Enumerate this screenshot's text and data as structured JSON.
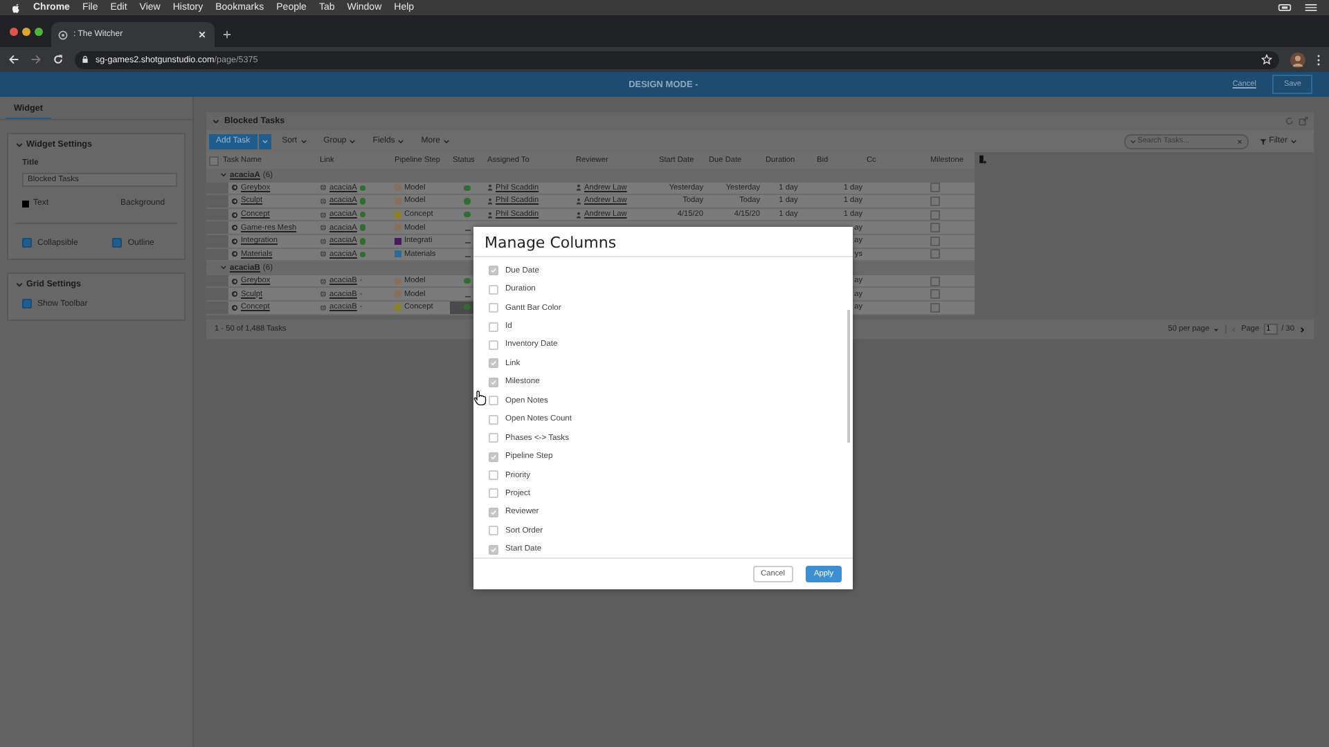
{
  "menubar": {
    "app": "Chrome",
    "items": [
      "File",
      "Edit",
      "View",
      "History",
      "Bookmarks",
      "People",
      "Tab",
      "Window",
      "Help"
    ]
  },
  "browser": {
    "tab_title": ": The Witcher",
    "url_host": "sg-games2.shotgunstudio.com",
    "url_path": "/page/5375"
  },
  "design_bar": {
    "title": "DESIGN MODE -",
    "cancel": "Cancel",
    "save": "Save"
  },
  "sidebar": {
    "tab": "Widget",
    "widget_settings": {
      "heading": "Widget Settings",
      "title_label": "Title",
      "title_value": "Blocked Tasks",
      "text_label": "Text",
      "background_label": "Background",
      "options": [
        {
          "label": "Collapsible",
          "checked": true
        },
        {
          "label": "Outline",
          "checked": true
        }
      ]
    },
    "grid_settings": {
      "heading": "Grid Settings",
      "options": [
        {
          "label": "Show Toolbar",
          "checked": true
        }
      ]
    }
  },
  "widget": {
    "title": "Blocked Tasks",
    "toolbar": {
      "add": "Add Task",
      "menus": [
        "Sort",
        "Group",
        "Fields",
        "More"
      ],
      "search_placeholder": "Search Tasks...",
      "filter": "Filter"
    },
    "all_selected": false,
    "columns": [
      "Task Name",
      "Link",
      "Pipeline Step",
      "Status",
      "Assigned To",
      "Reviewer",
      "Start Date",
      "Due Date",
      "Duration",
      "Bid",
      "Cc",
      "Milestone"
    ],
    "groups": [
      {
        "name": "acaciaA",
        "count": "(6)",
        "expanded": true,
        "rows": [
          {
            "task": "Greybox",
            "link": "acaciaA",
            "link_ok": true,
            "step": {
              "name": "Model",
              "color": "#8a6e5e"
            },
            "status_ok": true,
            "focused": false,
            "assigned": "Phil Scaddin",
            "reviewer": "Andrew Law",
            "start": "Yesterday",
            "due": "Yesterday",
            "duration": "1 day",
            "bid": "1 day",
            "milestone": false
          },
          {
            "task": "Sculpt",
            "link": "acaciaA",
            "link_ok": true,
            "step": {
              "name": "Model",
              "color": "#8a6e5e"
            },
            "status_ok": true,
            "focused": false,
            "assigned": "Phil Scaddin",
            "reviewer": "Andrew Law",
            "start": "Today",
            "due": "Today",
            "duration": "1 day",
            "bid": "1 day",
            "milestone": false
          },
          {
            "task": "Concept",
            "link": "acaciaA",
            "link_ok": true,
            "step": {
              "name": "Concept",
              "color": "#8c8028"
            },
            "status_ok": true,
            "focused": false,
            "assigned": "Phil Scaddin",
            "reviewer": "Andrew Law",
            "start": "4/15/20",
            "due": "4/15/20",
            "duration": "1 day",
            "bid": "1 day",
            "milestone": false
          },
          {
            "task": "Game-res Mesh",
            "link": "acaciaA",
            "link_ok": true,
            "step": {
              "name": "Model",
              "color": "#8a6e5e"
            },
            "status_ok": false,
            "focused": false,
            "bid": "ay",
            "milestone": false
          },
          {
            "task": "Integration",
            "link": "acaciaA",
            "link_ok": true,
            "step": {
              "name": "Integrati",
              "color": "#4a1a5e"
            },
            "status_ok": false,
            "focused": false,
            "bid": "ay",
            "milestone": false
          },
          {
            "task": "Materials",
            "link": "acaciaA",
            "link_ok": true,
            "step": {
              "name": "Materials",
              "color": "#2e6a95"
            },
            "status_ok": false,
            "focused": false,
            "bid": "ys",
            "milestone": false
          }
        ]
      },
      {
        "name": "acaciaB",
        "count": "(6)",
        "expanded": true,
        "rows": [
          {
            "task": "Greybox",
            "link": "acaciaB",
            "link_ok": false,
            "link_note": "-",
            "step": {
              "name": "Model",
              "color": "#8a6e5e"
            },
            "status_ok": true,
            "focused": false,
            "bid": "ay",
            "milestone": false
          },
          {
            "task": "Sculpt",
            "link": "acaciaB",
            "link_ok": false,
            "link_note": "-",
            "step": {
              "name": "Model",
              "color": "#8a6e5e"
            },
            "status_ok": false,
            "focused": false,
            "bid": "ay",
            "milestone": false
          },
          {
            "task": "Concept",
            "link": "acaciaB",
            "link_ok": false,
            "link_note": "-",
            "step": {
              "name": "Concept",
              "color": "#8c8028"
            },
            "status_ok": true,
            "focused": true,
            "bid": "ay",
            "milestone": false
          }
        ]
      }
    ],
    "footer": {
      "count": "1 - 50 of 1,488 Tasks",
      "per_page": "50 per page",
      "page_label": "Page",
      "page": "1",
      "total": "/ 30"
    }
  },
  "dialog": {
    "title": "Manage Columns",
    "items": [
      {
        "label": "Due Date",
        "checked": true
      },
      {
        "label": "Duration",
        "checked": false
      },
      {
        "label": "Gantt Bar Color",
        "checked": false
      },
      {
        "label": "Id",
        "checked": false
      },
      {
        "label": "Inventory Date",
        "checked": false
      },
      {
        "label": "Link",
        "checked": true
      },
      {
        "label": "Milestone",
        "checked": true
      },
      {
        "label": "Open Notes",
        "checked": false
      },
      {
        "label": "Open Notes Count",
        "checked": false
      },
      {
        "label": "Phases <-> Tasks",
        "checked": false
      },
      {
        "label": "Pipeline Step",
        "checked": true
      },
      {
        "label": "Priority",
        "checked": false
      },
      {
        "label": "Project",
        "checked": false
      },
      {
        "label": "Reviewer",
        "checked": true
      },
      {
        "label": "Sort Order",
        "checked": false
      },
      {
        "label": "Start Date",
        "checked": true
      }
    ],
    "cancel": "Cancel",
    "apply": "Apply"
  }
}
